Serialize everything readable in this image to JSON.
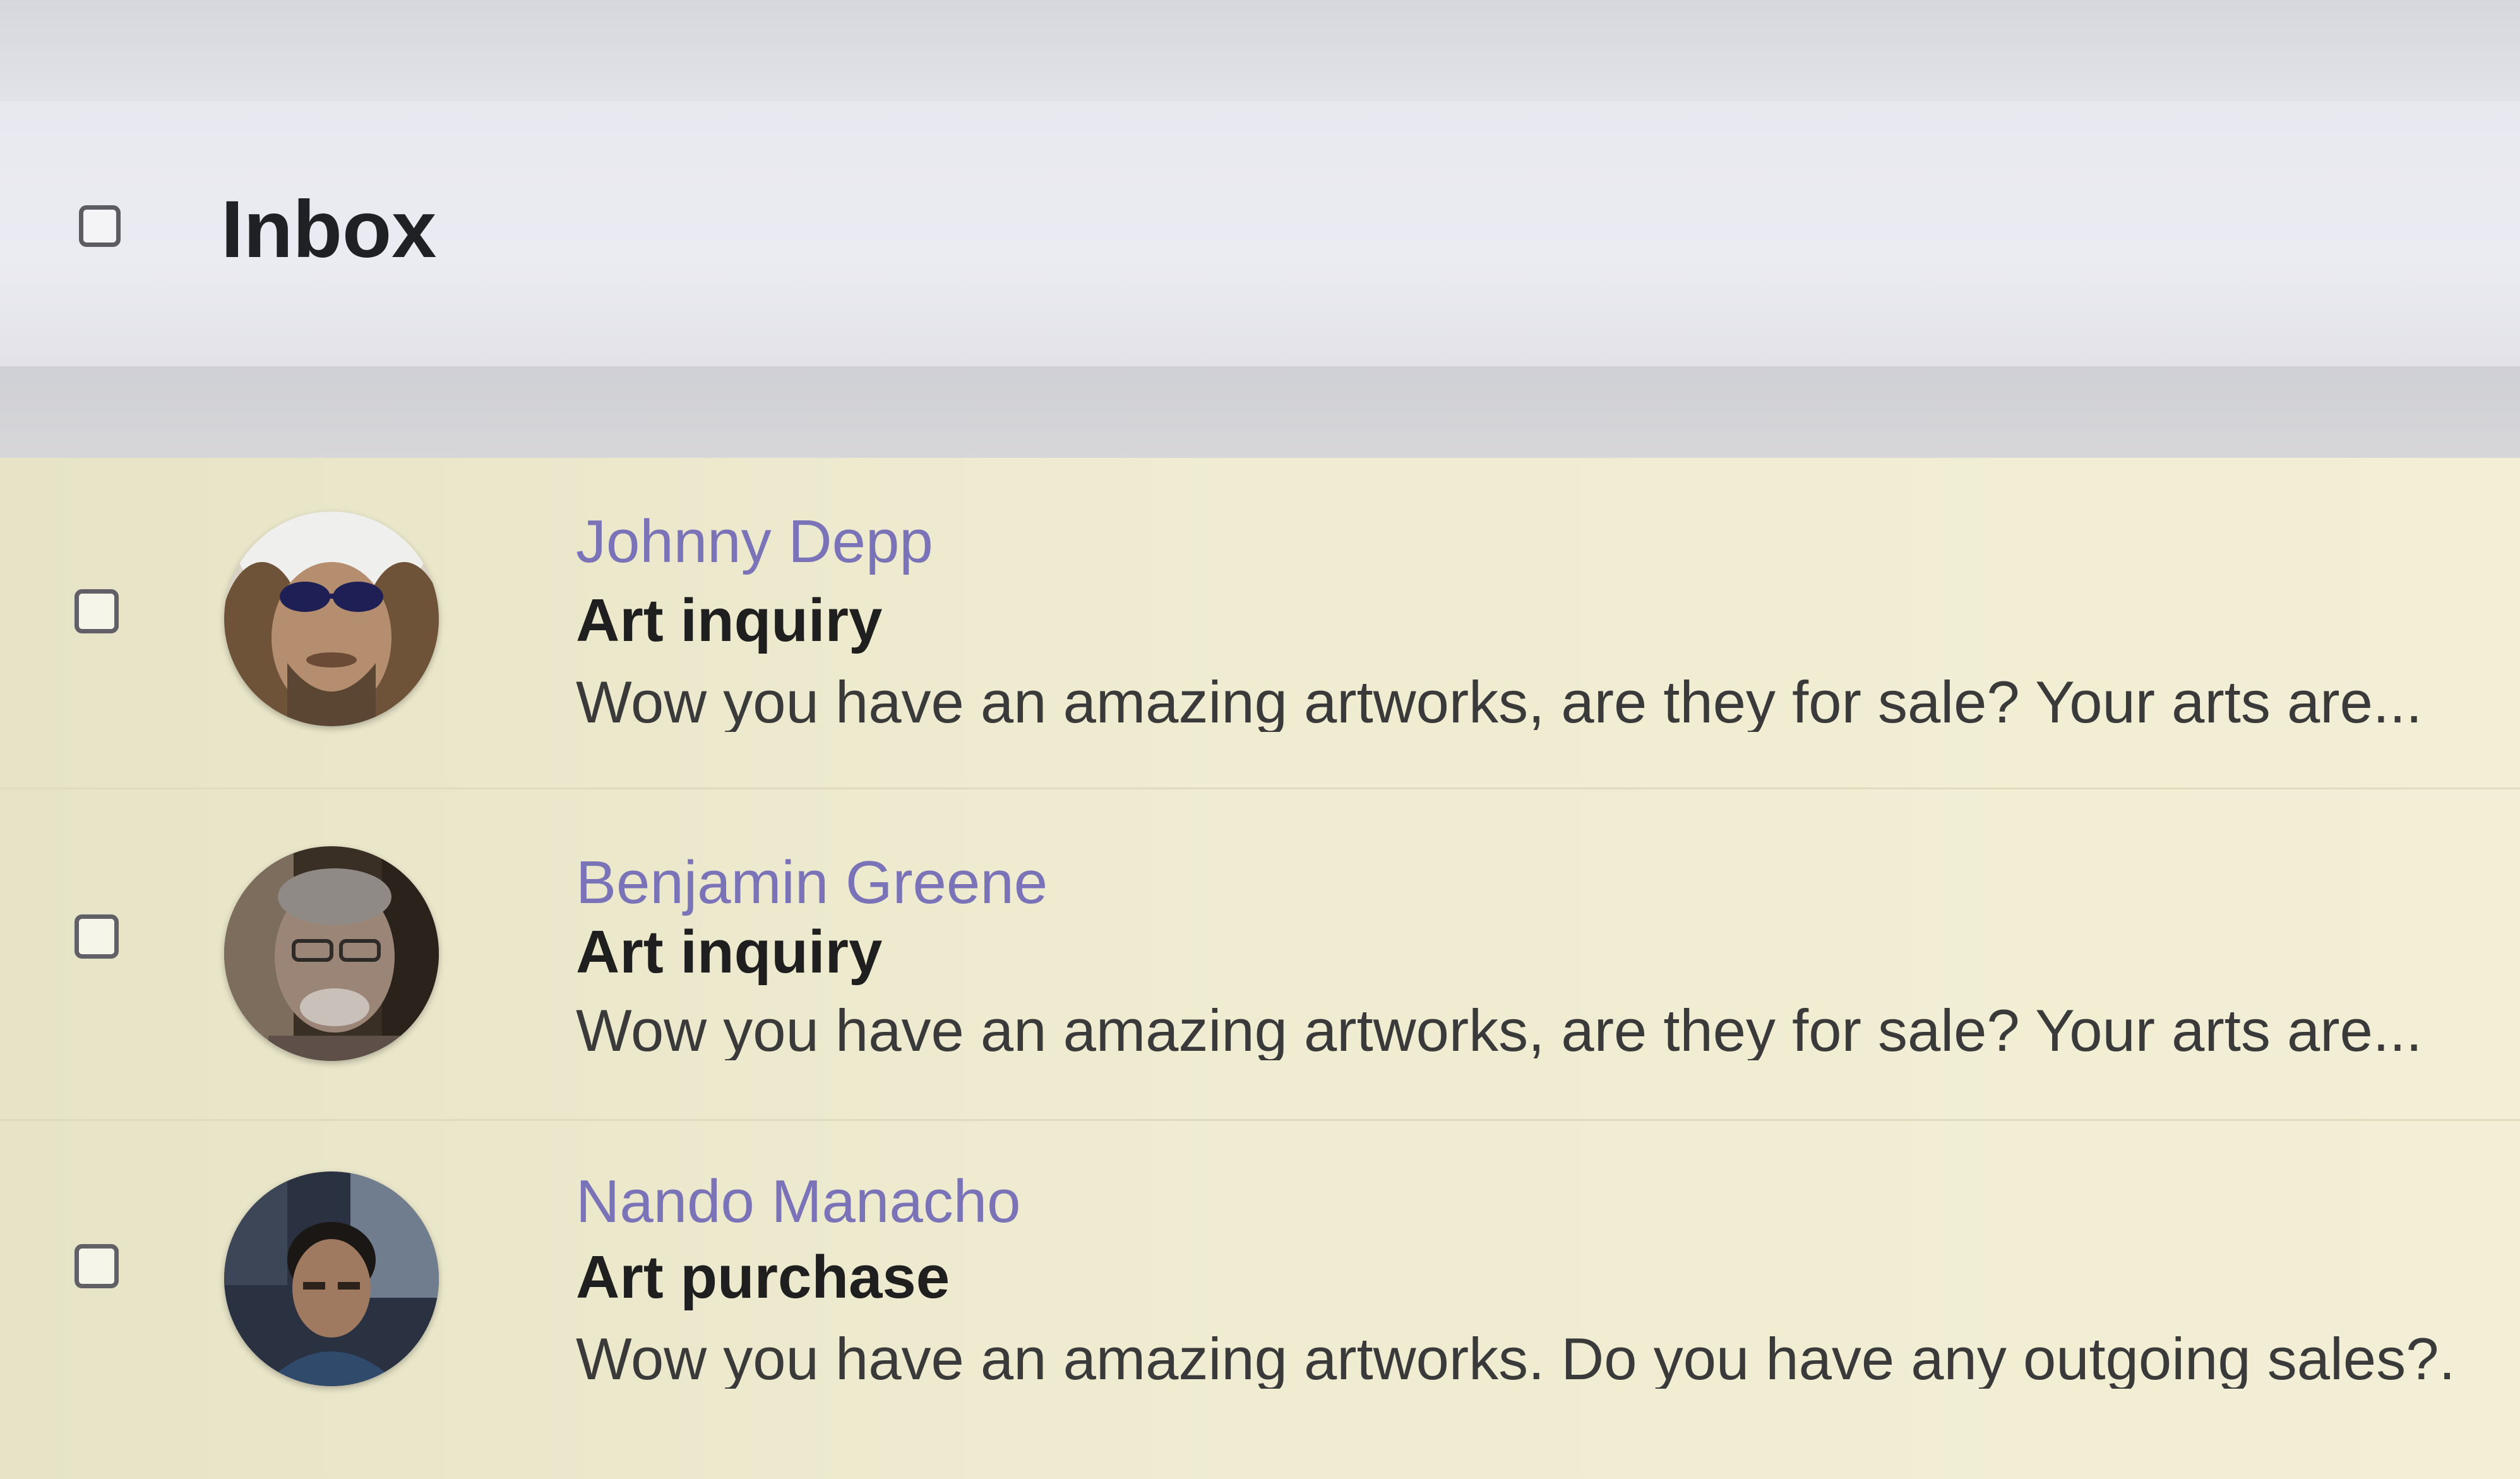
{
  "header": {
    "title": "Inbox"
  },
  "messages": [
    {
      "sender": "Johnny Depp",
      "subject": "Art inquiry",
      "preview": "Wow you have an amazing artworks, are they for sale? Your arts are..."
    },
    {
      "sender": "Benjamin Greene",
      "subject": "Art inquiry",
      "preview": "Wow you have an amazing artworks, are they for sale? Your arts are..."
    },
    {
      "sender": "Nando Manacho",
      "subject": "Art purchase",
      "preview": "Wow you have an amazing artworks. Do you have any outgoing sales?..."
    }
  ],
  "colors": {
    "sender": "#7b73b8",
    "row_background": "#eeebd0",
    "header_background": "#ebebf2"
  }
}
